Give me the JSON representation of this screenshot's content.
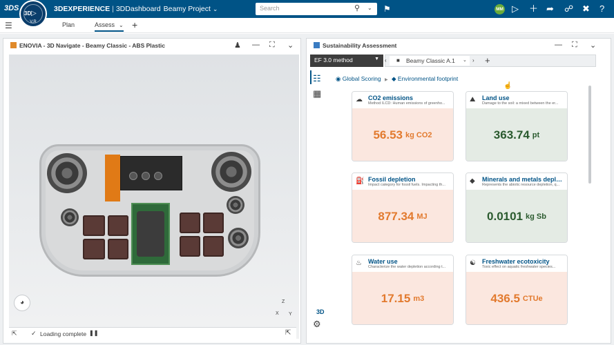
{
  "app": {
    "brand_primary": "3DEXPERIENCE",
    "brand_separator": "|",
    "brand_secondary": "3DDashboard",
    "project": "Beamy Project",
    "compass_top": "3D",
    "compass_bottom": "V,R"
  },
  "search": {
    "placeholder": "Search"
  },
  "user": {
    "initials": "MM"
  },
  "tabs": [
    {
      "label": "Plan"
    },
    {
      "label": "Assess"
    }
  ],
  "left_panel": {
    "title": "ENOVIA - 3D Navigate - Beamy Classic - ABS Plastic",
    "status": "Loading complete",
    "axes": {
      "z": "Z",
      "x": "X",
      "y": "Y"
    }
  },
  "right_panel": {
    "title": "Sustainability Assessment",
    "method": "EF 3.0 method",
    "variant": "Beamy Classic A.1",
    "breadcrumb": [
      "Global Scoring",
      "Environmental footprint"
    ],
    "side_label": "3D",
    "cards": [
      {
        "title": "CO2 emissions",
        "desc": "Method ILCD: Human emissions of greenho...",
        "value": "56.53",
        "unit": "kg CO2",
        "tone": "orange",
        "icon": "co2-icon"
      },
      {
        "title": "Land use",
        "desc": "Damage to the soil: a mixed between the er...",
        "value": "363.74",
        "unit": "pt",
        "tone": "green",
        "icon": "land-icon"
      },
      {
        "title": "Fossil depletion",
        "desc": "Impact category for fossil fuels. Impacting th...",
        "value": "877.34",
        "unit": "MJ",
        "tone": "orange",
        "icon": "fossil-icon"
      },
      {
        "title": "Minerals and metals deplet...",
        "desc": "Represents the abiotic resource depletion, q...",
        "value": "0.0101",
        "unit": "kg Sb",
        "tone": "green",
        "icon": "minerals-icon"
      },
      {
        "title": "Water use",
        "desc": "Characterize the water depletion according t...",
        "value": "17.15",
        "unit": "m3",
        "tone": "orange",
        "icon": "water-icon"
      },
      {
        "title": "Freshwater ecotoxicity",
        "desc": "Toxic effect on aquatic freshwater species...",
        "value": "436.5",
        "unit": "CTUe",
        "tone": "orange",
        "icon": "ecotox-icon"
      }
    ]
  },
  "colors": {
    "topbar": "#005386",
    "accent_orange": "#e27a2e",
    "accent_green": "#2a5a2e"
  }
}
